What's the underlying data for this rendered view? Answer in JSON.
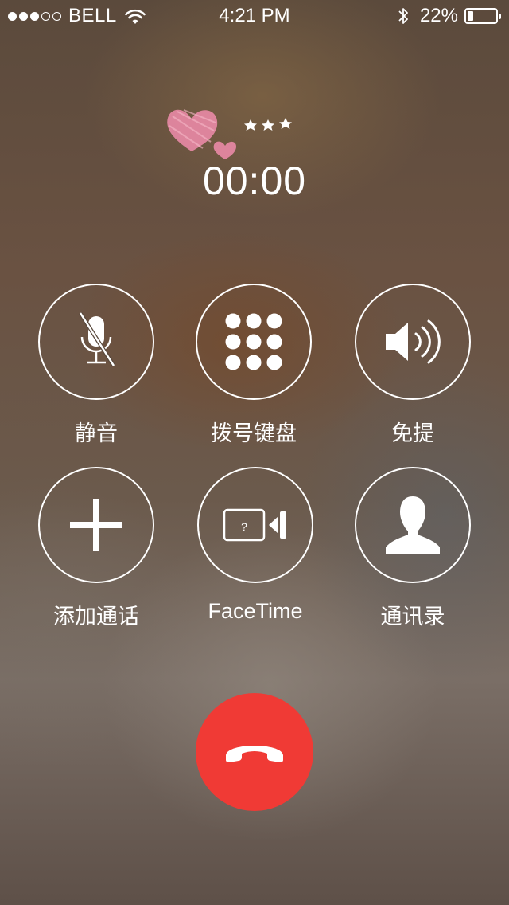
{
  "status_bar": {
    "signal_total": 5,
    "signal_filled": 3,
    "carrier": "BELL",
    "time": "4:21 PM",
    "battery_percent_text": "22%",
    "battery_level": 0.22
  },
  "call": {
    "duration": "00:00",
    "caller_image": "heart-doodle-with-stars"
  },
  "controls": [
    {
      "id": "mute",
      "label": "静音",
      "icon": "muted-microphone-icon"
    },
    {
      "id": "keypad",
      "label": "拨号键盘",
      "icon": "keypad-icon"
    },
    {
      "id": "speaker",
      "label": "免提",
      "icon": "speaker-icon"
    },
    {
      "id": "add_call",
      "label": "添加通话",
      "icon": "plus-icon"
    },
    {
      "id": "facetime",
      "label": "FaceTime",
      "icon": "video-camera-icon"
    },
    {
      "id": "contacts",
      "label": "通讯录",
      "icon": "person-silhouette-icon"
    }
  ],
  "end_call": {
    "icon": "phone-hangup-icon"
  },
  "colors": {
    "end_call": "#f03a35",
    "text": "#ffffff",
    "heart": "#e98aa6"
  }
}
